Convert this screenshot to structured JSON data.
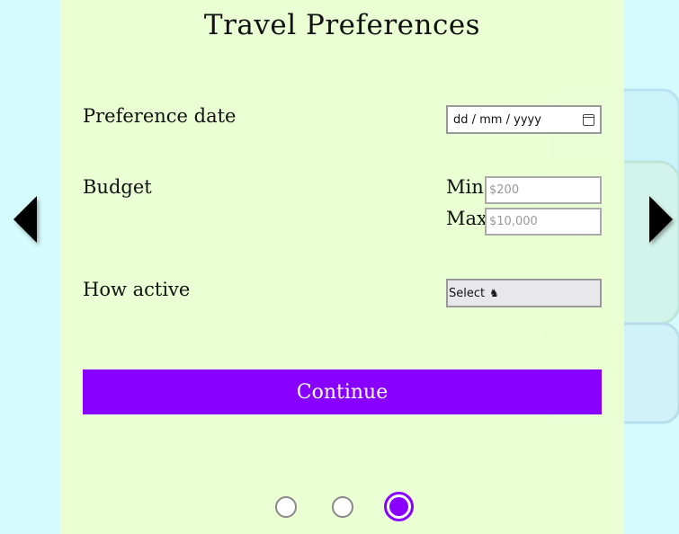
{
  "page": {
    "title": "Travel Preferences"
  },
  "form": {
    "date": {
      "label": "Preference date",
      "value": "dd / mm / yyyy"
    },
    "budget": {
      "label": "Budget",
      "min_label": "Min",
      "min_placeholder": "$200",
      "max_label": "Max",
      "max_placeholder": "$10,000"
    },
    "activity": {
      "label": "How active",
      "selected": "Select",
      "icon_glyph": "♞"
    },
    "continue_label": "Continue"
  },
  "pagination": {
    "total_steps": 3,
    "current_step": 3
  },
  "colors": {
    "accent": "#8800ff",
    "panel": "#ecffd0",
    "background": "#d6fbfd"
  },
  "icons": {
    "prev": "chevron-left-icon",
    "next": "chevron-right-icon",
    "calendar": "calendar-icon",
    "activity": "knight-icon"
  }
}
